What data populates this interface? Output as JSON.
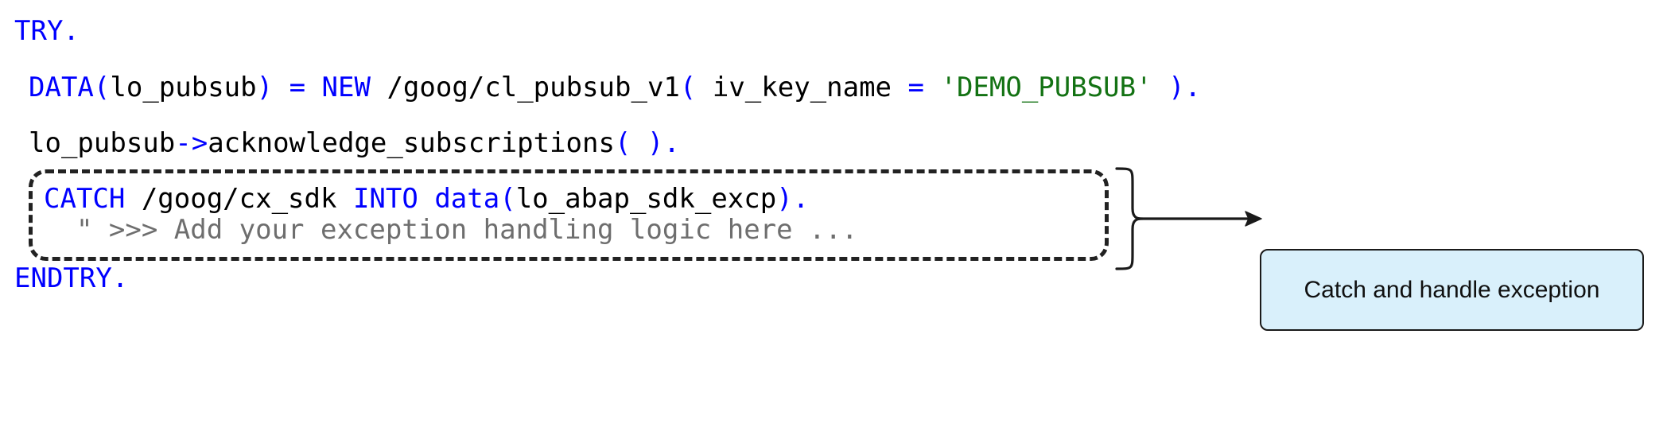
{
  "code": {
    "language": "ABAP",
    "lines": [
      {
        "id": "line-try",
        "tokens": [
          {
            "text": "TRY",
            "style": "kw"
          },
          {
            "text": ".",
            "style": "kw"
          }
        ]
      },
      {
        "id": "line-data",
        "tokens": [
          {
            "text": "DATA",
            "style": "kw"
          },
          {
            "text": "(",
            "style": "kw"
          },
          {
            "text": "lo_pubsub",
            "style": "plain"
          },
          {
            "text": ")",
            "style": "kw"
          },
          {
            "text": " ",
            "style": "plain"
          },
          {
            "text": "=",
            "style": "kw"
          },
          {
            "text": " ",
            "style": "plain"
          },
          {
            "text": "NEW",
            "style": "kw"
          },
          {
            "text": " /goog/cl_pubsub_v1",
            "style": "plain"
          },
          {
            "text": "(",
            "style": "kw"
          },
          {
            "text": " iv_key_name ",
            "style": "plain"
          },
          {
            "text": "=",
            "style": "kw"
          },
          {
            "text": " ",
            "style": "plain"
          },
          {
            "text": "'DEMO_PUBSUB'",
            "style": "str"
          },
          {
            "text": " ",
            "style": "plain"
          },
          {
            "text": ")",
            "style": "kw"
          },
          {
            "text": ".",
            "style": "kw"
          }
        ]
      },
      {
        "id": "line-call",
        "tokens": [
          {
            "text": "lo_pubsub",
            "style": "plain"
          },
          {
            "text": "->",
            "style": "kw"
          },
          {
            "text": "acknowledge_subscriptions",
            "style": "plain"
          },
          {
            "text": "(",
            "style": "kw"
          },
          {
            "text": " ",
            "style": "plain"
          },
          {
            "text": ")",
            "style": "kw"
          },
          {
            "text": ".",
            "style": "kw"
          }
        ]
      },
      {
        "id": "line-catch",
        "tokens": [
          {
            "text": "CATCH",
            "style": "kw"
          },
          {
            "text": " /goog/cx_sdk ",
            "style": "plain"
          },
          {
            "text": "INTO",
            "style": "kw"
          },
          {
            "text": " ",
            "style": "plain"
          },
          {
            "text": "data",
            "style": "kw"
          },
          {
            "text": "(",
            "style": "kw"
          },
          {
            "text": "lo_abap_sdk_excp",
            "style": "plain"
          },
          {
            "text": ")",
            "style": "kw"
          },
          {
            "text": ".",
            "style": "kw"
          }
        ]
      },
      {
        "id": "line-comment",
        "tokens": [
          {
            "text": "  \" >>> Add your exception handling logic here ...",
            "style": "comment"
          }
        ]
      },
      {
        "id": "line-endtry",
        "tokens": [
          {
            "text": "ENDTRY",
            "style": "kw"
          },
          {
            "text": ".",
            "style": "kw"
          }
        ]
      }
    ]
  },
  "annotation": {
    "callout_label": "Catch and handle exception",
    "highlight_region": "catch-block",
    "connector": "curly-brace-arrow"
  },
  "colors": {
    "keyword": "#0000ff",
    "plain": "#000000",
    "string": "#137213",
    "comment": "#6e6e6e",
    "callout_fill": "#d9f0fb",
    "callout_border": "#1a1a1a",
    "dash_border": "#222222"
  }
}
